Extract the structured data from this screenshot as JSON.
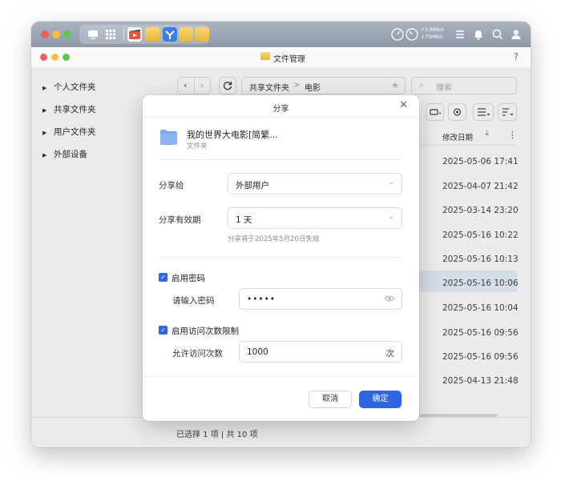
{
  "window": {
    "title": "文件管理",
    "help_icon": "?"
  },
  "tray": {
    "cpu_label": "CPU",
    "ram_label": "RAM",
    "net_up": "3.9MB/s",
    "net_down": "75MB/s"
  },
  "sidebar": {
    "items": [
      {
        "label": "个人文件夹"
      },
      {
        "label": "共享文件夹"
      },
      {
        "label": "用户文件夹"
      },
      {
        "label": "外部设备"
      }
    ]
  },
  "toolbar": {
    "path": [
      "共享文件夹",
      "电影"
    ],
    "path_separator": ">",
    "search_placeholder": "搜索"
  },
  "table": {
    "column_modified": "修改日期",
    "dates": [
      "2025-05-06 17:41",
      "2025-04-07 21:42",
      "2025-03-14 23:20",
      "2025-05-16 10:22",
      "2025-05-16 10:13",
      "2025-05-16 10:06",
      "2025-05-16 10:04",
      "2025-05-16 09:56",
      "2025-05-16 09:56",
      "2025-04-13 21:48"
    ]
  },
  "status": {
    "text": "已选择 1 项 | 共 10 项"
  },
  "dialog": {
    "title": "分享",
    "file_name": "我的世界大电影[简繁...",
    "file_type": "文件夹",
    "share_to_label": "分享给",
    "share_to_value": "外部用户",
    "expiry_label": "分享有效期",
    "expiry_value": "1 天",
    "expiry_hint": "分享将于2025年5月20日失效",
    "password_enabled": true,
    "password_checkbox_label": "启用密码",
    "password_label": "请输入密码",
    "password_value": "•••••",
    "limit_enabled": true,
    "limit_checkbox_label": "启用访问次数限制",
    "limit_label": "允许访问次数",
    "limit_value": "1000",
    "limit_unit": "次",
    "cancel_label": "取消",
    "ok_label": "确定"
  },
  "colors": {
    "accent": "#2f66e0",
    "highlight_row": "#e8f0fd"
  }
}
